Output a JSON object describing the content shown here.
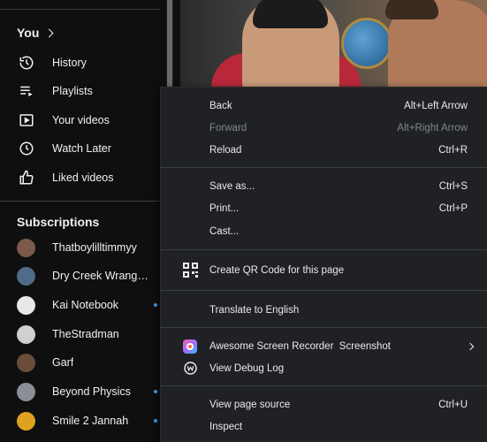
{
  "sidebar": {
    "you_label": "You",
    "nav": [
      {
        "label": "History",
        "icon": "history-icon"
      },
      {
        "label": "Playlists",
        "icon": "playlists-icon"
      },
      {
        "label": "Your videos",
        "icon": "your-videos-icon"
      },
      {
        "label": "Watch Later",
        "icon": "watch-later-icon"
      },
      {
        "label": "Liked videos",
        "icon": "liked-videos-icon"
      }
    ],
    "subscriptions_title": "Subscriptions",
    "subscriptions": [
      {
        "name": "Thatboylilltimmyy",
        "new": false,
        "color": "#7a5a48"
      },
      {
        "name": "Dry Creek Wrangler ...",
        "new": false,
        "color": "#4f6b88"
      },
      {
        "name": "Kai Notebook",
        "new": true,
        "color": "#e8e8e8"
      },
      {
        "name": "TheStradman",
        "new": false,
        "color": "#d0d0d0"
      },
      {
        "name": "Garf",
        "new": false,
        "color": "#6a4d3a"
      },
      {
        "name": "Beyond Physics",
        "new": true,
        "color": "#8a8f96"
      },
      {
        "name": "Smile 2 Jannah",
        "new": true,
        "color": "#e0a020"
      }
    ]
  },
  "menu": {
    "items": [
      {
        "label": "Back",
        "shortcut": "Alt+Left Arrow",
        "disabled": false
      },
      {
        "label": "Forward",
        "shortcut": "Alt+Right Arrow",
        "disabled": true
      },
      {
        "label": "Reload",
        "shortcut": "Ctrl+R",
        "disabled": false
      },
      {
        "label": "Save as...",
        "shortcut": "Ctrl+S",
        "disabled": false
      },
      {
        "label": "Print...",
        "shortcut": "Ctrl+P",
        "disabled": false
      },
      {
        "label": "Cast...",
        "shortcut": "",
        "disabled": false
      },
      {
        "label": "Create QR Code for this page",
        "shortcut": "",
        "icon": "qr-code-icon"
      },
      {
        "label": "Translate to English",
        "shortcut": ""
      },
      {
        "label": "Awesome Screen Recorder  Screenshot",
        "shortcut": "",
        "icon": "screen-recorder-icon",
        "submenu": true
      },
      {
        "label": "View Debug Log",
        "shortcut": "",
        "icon": "debug-log-icon"
      },
      {
        "label": "View page source",
        "shortcut": "Ctrl+U"
      },
      {
        "label": "Inspect",
        "shortcut": ""
      }
    ]
  },
  "colors": {
    "accent_dot": "#3ea6ff",
    "menu_bg": "#202124",
    "page_bg": "#0f0f0f"
  }
}
